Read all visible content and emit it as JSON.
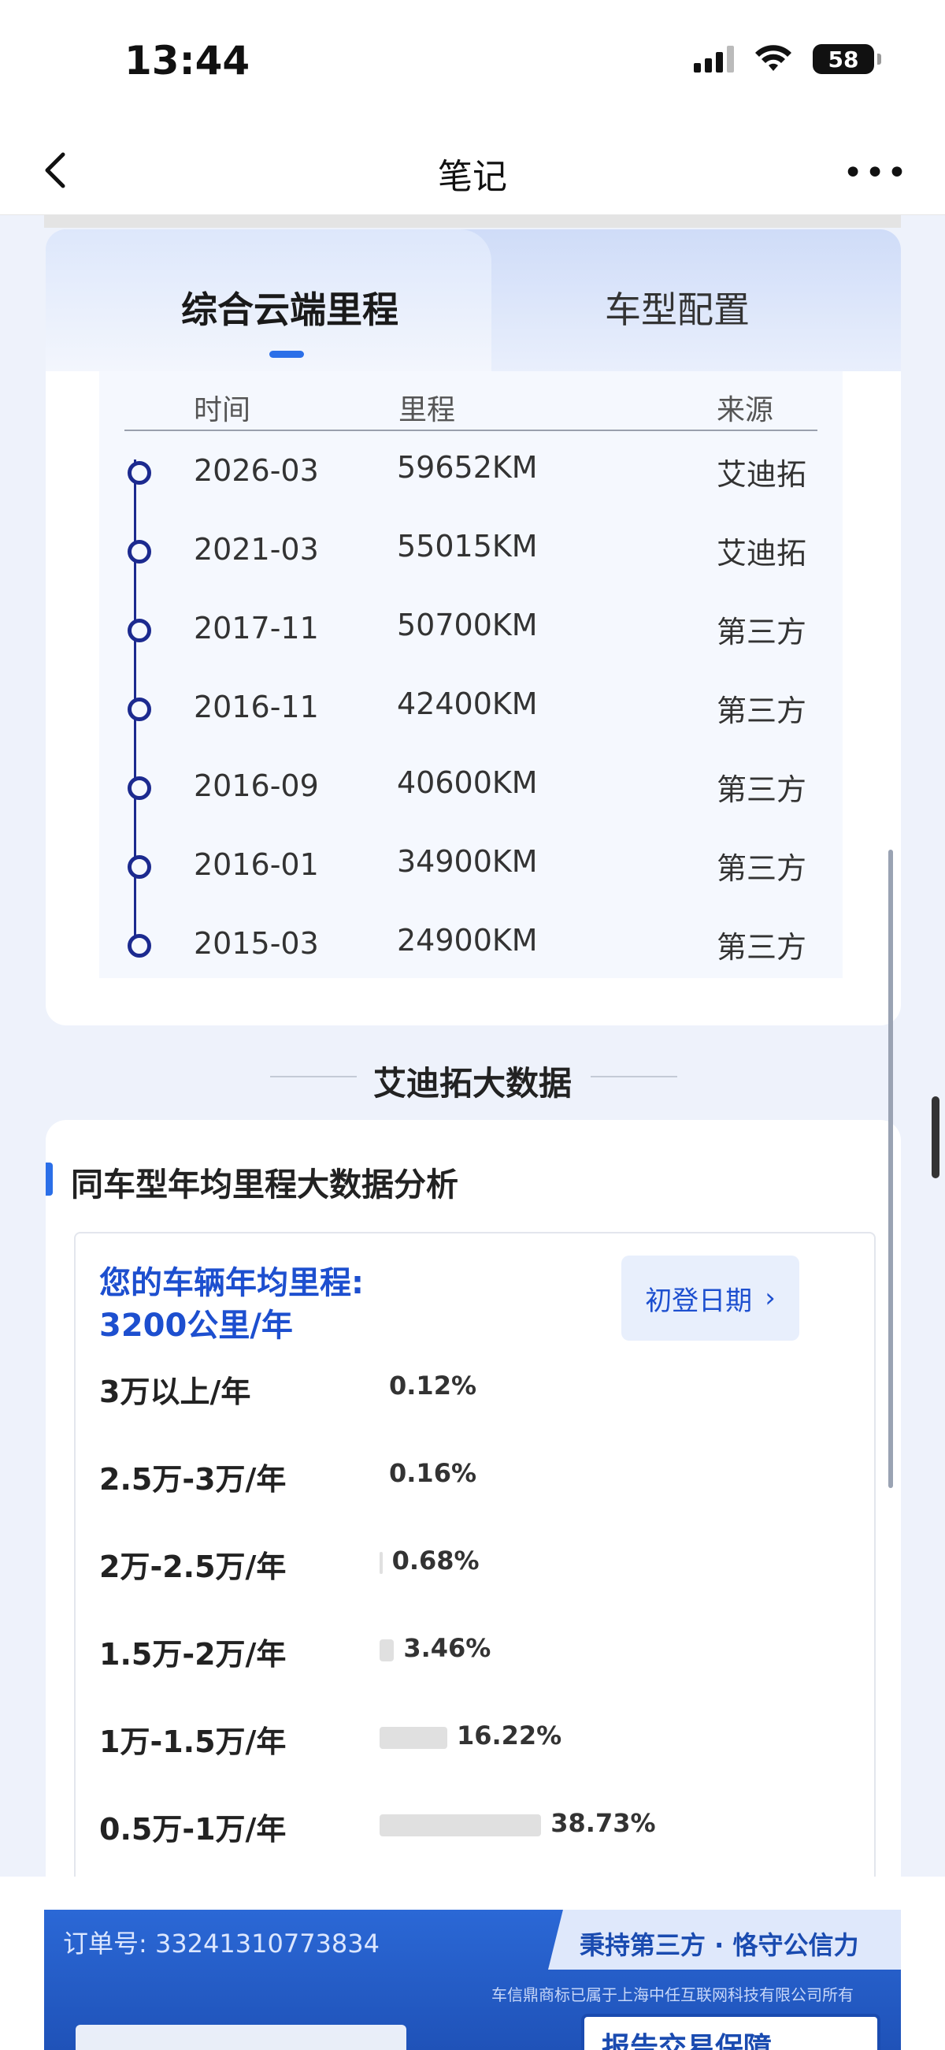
{
  "status_bar": {
    "time": "13:44",
    "battery": "58"
  },
  "nav": {
    "title": "笔记"
  },
  "tabs": [
    {
      "label": "综合云端里程"
    },
    {
      "label": "车型配置"
    }
  ],
  "timeline": {
    "headers": {
      "time": "时间",
      "mileage": "里程",
      "source": "来源"
    },
    "rows": [
      {
        "time": "2026-03",
        "mileage": "59652KM",
        "source": "艾迪拓"
      },
      {
        "time": "2021-03",
        "mileage": "55015KM",
        "source": "艾迪拓"
      },
      {
        "time": "2017-11",
        "mileage": "50700KM",
        "source": "第三方"
      },
      {
        "time": "2016-11",
        "mileage": "42400KM",
        "source": "第三方"
      },
      {
        "time": "2016-09",
        "mileage": "40600KM",
        "source": "第三方"
      },
      {
        "time": "2016-01",
        "mileage": "34900KM",
        "source": "第三方"
      },
      {
        "time": "2015-03",
        "mileage": "24900KM",
        "source": "第三方"
      }
    ]
  },
  "section": {
    "title": "艾迪拓大数据"
  },
  "analysis": {
    "title": "同车型年均里程大数据分析",
    "avg_label": "您的车辆年均里程:",
    "avg_value": "3200公里/年",
    "date_button": "初登日期",
    "distribution": [
      {
        "label": "3万以上/年",
        "percent_text": "0.12%",
        "percent": 0.12
      },
      {
        "label": "2.5万-3万/年",
        "percent_text": "0.16%",
        "percent": 0.16
      },
      {
        "label": "2万-2.5万/年",
        "percent_text": "0.68%",
        "percent": 0.68
      },
      {
        "label": "1.5万-2万/年",
        "percent_text": "3.46%",
        "percent": 3.46
      },
      {
        "label": "1万-1.5万/年",
        "percent_text": "16.22%",
        "percent": 16.22
      },
      {
        "label": "0.5万-1万/年",
        "percent_text": "38.73%",
        "percent": 38.73
      }
    ]
  },
  "banner": {
    "order": "订单号: 33241310773834",
    "slogan": "秉持第三方 · 恪守公信力",
    "company": "车信鼎商标已属于上海中任互联网科技有限公司所有",
    "badge": "报告交易保障"
  }
}
